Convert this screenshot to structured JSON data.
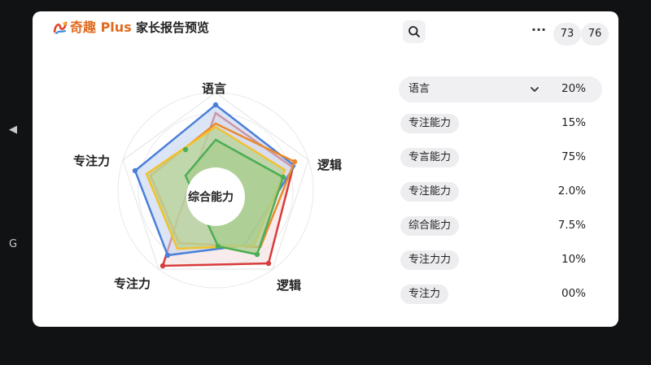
{
  "side": {
    "back_glyph": "◀",
    "refresh_glyph": "G"
  },
  "header": {
    "brand": "奇趣 Plus",
    "title": "家长报告预览",
    "search_icon": "search-icon",
    "more": "···",
    "btn_a": "73",
    "btn_b": "76"
  },
  "radar": {
    "axes": [
      "语言",
      "逻辑",
      "逻辑",
      "专注力",
      "专注力"
    ],
    "center_label": "综合能力",
    "colors": {
      "blue": "#4a7fd8",
      "orange": "#e98a2c",
      "red": "#d83b3b",
      "yellow": "#f2c12e",
      "green": "#4cae52",
      "fill": "#a8cc8e"
    }
  },
  "list": [
    {
      "label": "语言",
      "value": "20%",
      "selected": true
    },
    {
      "label": "专注能力",
      "value": "15%"
    },
    {
      "label": "专言能力",
      "value": "75%"
    },
    {
      "label": "专注能力",
      "value": "2.0%"
    },
    {
      "label": "综合能力",
      "value": "7.5%"
    },
    {
      "label": "专注力力",
      "value": "10%"
    },
    {
      "label": "专注力",
      "value": "00%"
    }
  ]
}
